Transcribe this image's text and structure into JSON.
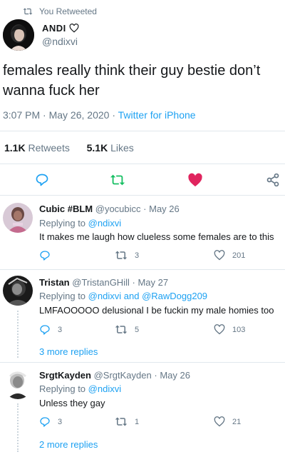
{
  "retweet_banner": "You Retweeted",
  "tweet": {
    "name": "ANDI",
    "handle": "@ndixvi",
    "text": "females really think their guy bestie don’t wanna fuck her",
    "time": "3:07 PM",
    "date": "May 26, 2020",
    "sep": "·",
    "client": "Twitter for iPhone",
    "retweets_count": "1.1K",
    "retweets_label": "Retweets",
    "likes_count": "5.1K",
    "likes_label": "Likes",
    "liked": true,
    "retweeted": true
  },
  "colors": {
    "accent": "#1da1f2",
    "retweet_green": "#17bf63",
    "like_red": "#e0245e",
    "muted": "#657786",
    "divider": "#e1e8ed"
  },
  "replies": [
    {
      "name": "Cubic #BLM",
      "handle": "@yocubicc",
      "date": "May 26",
      "replying_prefix": "Replying to",
      "replying_to": "@ndixvi",
      "replying_and": "",
      "replying_to_2": "",
      "text": "It makes me laugh how clueless some females are to this",
      "reply_count": "",
      "retweet_count": "3",
      "like_count": "201",
      "more_replies": ""
    },
    {
      "name": "Tristan",
      "handle": "@TristanGHill",
      "date": "May 27",
      "replying_prefix": "Replying to",
      "replying_to": "@ndixvi",
      "replying_and": "and",
      "replying_to_2": "@RawDogg209",
      "text": "LMFAOOOOO delusional I be fuckin my male homies too",
      "reply_count": "3",
      "retweet_count": "5",
      "like_count": "103",
      "more_replies": "3 more replies"
    },
    {
      "name": "SrgtKayden",
      "handle": "@SrgtKayden",
      "date": "May 26",
      "replying_prefix": "Replying to",
      "replying_to": "@ndixvi",
      "replying_and": "",
      "replying_to_2": "",
      "text": "Unless they gay",
      "reply_count": "3",
      "retweet_count": "1",
      "like_count": "21",
      "more_replies": "2 more replies"
    }
  ],
  "icons": {
    "retweet_banner": "retweet-icon",
    "verified_like": "heart-outline-icon",
    "reply": "reply-icon",
    "retweet": "retweet-icon",
    "like": "heart-icon",
    "share": "share-icon"
  }
}
